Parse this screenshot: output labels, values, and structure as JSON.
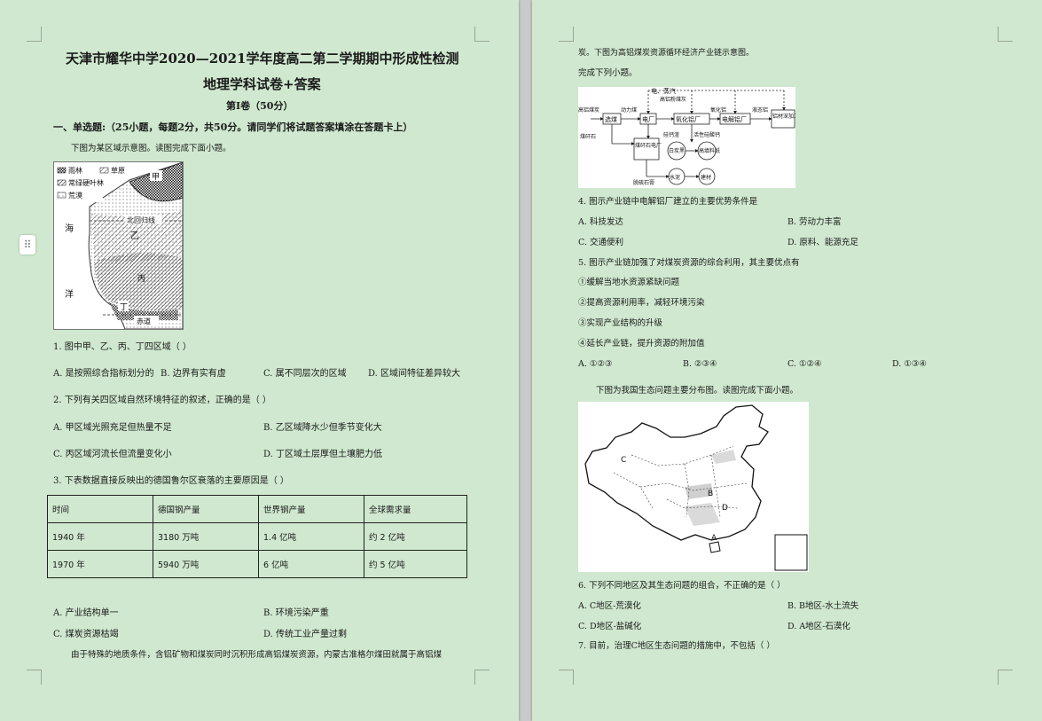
{
  "left": {
    "title1": "天津市耀华中学2020—2021学年度高二第二学期期中形成性检测",
    "title2": "地理学科试卷+答案",
    "volume": "第Ⅰ卷（50分）",
    "section": "一、单选题:（25小题，每题2分，共50分。请同学们将试题答案填涂在答题卡上）",
    "intro1": "下图为某区域示意图。读图完成下面小题。",
    "map1": {
      "legend": [
        "雨林",
        "草原",
        "常绿硬叶林",
        "荒漠"
      ],
      "labels": {
        "jia": "甲",
        "yi": "乙",
        "bing": "丙",
        "ding": "丁",
        "hai": "海",
        "yang": "洋",
        "tropic": "北回归线",
        "equator": "赤道"
      }
    },
    "q1": "1. 图中甲、乙、丙、丁四区域（    ）",
    "q1_opts": [
      "A. 是按照综合指标划分的",
      "B. 边界有实有虚",
      "C. 属不同层次的区域",
      "D. 区域间特征差异较大"
    ],
    "q2": "2. 下列有关四区域自然环境特征的叙述，正确的是（    ）",
    "q2_opts": [
      "A. 甲区域光照充足但热量不足",
      "B. 乙区域降水少但季节变化大",
      "C. 丙区域河流长但流量变化小",
      "D. 丁区域土层厚但土壤肥力低"
    ],
    "q3": "3. 下表数据直接反映出的德国鲁尔区衰落的主要原因是（    ）",
    "table": {
      "header": [
        "时间",
        "德国钢产量",
        "世界钢产量",
        "全球需求量"
      ],
      "rows": [
        [
          "1940 年",
          "3180 万吨",
          "1.4 亿吨",
          "约 2 亿吨"
        ],
        [
          "1970 年",
          "5940 万吨",
          "6 亿吨",
          "约 5 亿吨"
        ]
      ]
    },
    "q3_opts": [
      "A. 产业结构单一",
      "B. 环境污染严重",
      "C. 煤炭资源枯竭",
      "D. 传统工业产量过剩"
    ],
    "intro2": "由于特殊的地质条件，含铝矿物和煤炭同时沉积形成高铝煤炭资源，内蒙古准格尔煤田就属于高铝煤"
  },
  "right": {
    "cont": "炭。下图为高铝煤炭资源循环经济产业链示意图。",
    "task": "完成下列小题。",
    "chain": {
      "labels": [
        "电、蒸汽",
        "高铝粉煤灰",
        "高铝煤炭",
        "动力煤",
        "选煤",
        "电厂",
        "氧化铝厂",
        "氧化铝",
        "电解铝厂",
        "液态铝",
        "铝材深加工厂",
        "煤矸石",
        "煤矸石电厂",
        "硅钙渣",
        "活性硅酸钙",
        "白炭黑",
        "高填料纸",
        "脱硫石膏",
        "水泥",
        "建材"
      ]
    },
    "q4": "4. 图示产业链中电解铝厂建立的主要优势条件是",
    "q4_opts": [
      "A. 科技发达",
      "B. 劳动力丰富",
      "C. 交通便利",
      "D. 原料、能源充足"
    ],
    "q5": "5. 图示产业链加强了对煤炭资源的综合利用，其主要优点有",
    "q5_items": [
      "①缓解当地水资源紧缺问题",
      "②提高资源利用率，减轻环境污染",
      "③实现产业结构的升级",
      "④延长产业链，提升资源的附加值"
    ],
    "q5_opts": [
      "A. ①②③",
      "B. ②③④",
      "C. ①②④",
      "D. ①③④"
    ],
    "intro3": "下图为我国生态问题主要分布图。读图完成下面小题。",
    "map2": {
      "labels": [
        "C",
        "B",
        "D",
        "A"
      ]
    },
    "q6": "6. 下列不同地区及其生态问题的组合，不正确的是（    ）",
    "q6_opts": [
      "A. C地区-荒漠化",
      "B. B地区-水土流失",
      "C. D地区-盐碱化",
      "D. A地区-石漠化"
    ],
    "q7": "7. 目前，治理C地区生态问题的措施中，不包括（    ）"
  },
  "colors": {
    "page": "#cfe8cf",
    "desk": "#c9cbca"
  },
  "icons": {
    "grip": "drag-handle-icon"
  }
}
